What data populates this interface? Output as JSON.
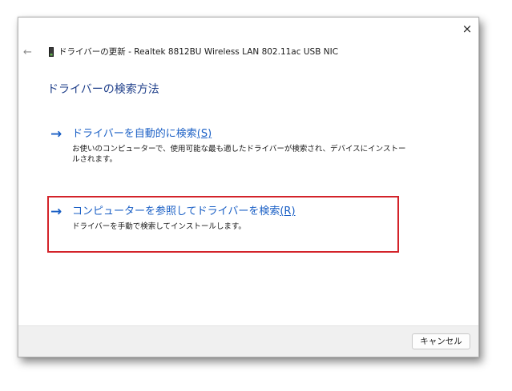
{
  "window": {
    "close_glyph": "×",
    "back_glyph": "←"
  },
  "header": {
    "title": "ドライバーの更新 - Realtek 8812BU Wireless LAN 802.11ac USB NIC",
    "device_icon": "usb-device-icon"
  },
  "page": {
    "heading": "ドライバーの検索方法"
  },
  "options": [
    {
      "arrow": "→",
      "title": "ドライバーを自動的に検索",
      "hotkey": "(S)",
      "description": "お使いのコンピューターで、使用可能な最も適したドライバーが検索され、デバイスにインストールされます。"
    },
    {
      "arrow": "→",
      "title": "コンピューターを参照してドライバーを検索",
      "hotkey": "(R)",
      "description": "ドライバーを手動で検索してインストールします。"
    }
  ],
  "footer": {
    "cancel_label": "キャンセル"
  },
  "colors": {
    "link": "#1a5fc5",
    "heading": "#1f3f8a",
    "highlight": "#d3232a",
    "footer_bg": "#f0f0f0"
  }
}
